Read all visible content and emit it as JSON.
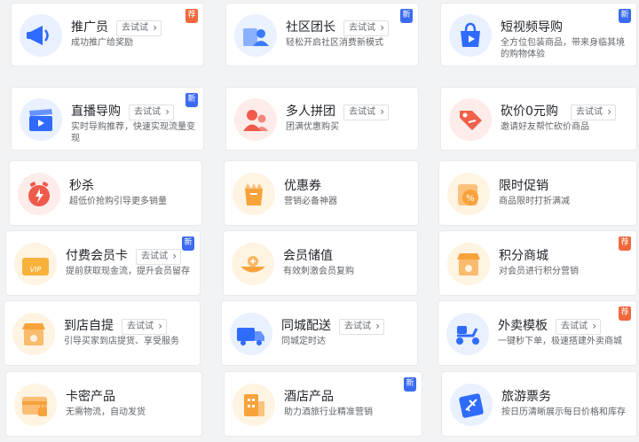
{
  "try_label": "去试试",
  "badge_colors": {
    "荐": "#f0683c",
    "新": "#3b6bf0"
  },
  "cards": [
    {
      "title": "推广员",
      "desc": "成功推广给奖励",
      "try": true,
      "badge": "荐",
      "icon": "megaphone-icon",
      "color": "#2f6bff",
      "bg": "#e9f0ff"
    },
    {
      "title": "社区团长",
      "desc": "轻松开启社区消费新模式",
      "try": true,
      "badge": "新",
      "icon": "community-leader-icon",
      "color": "#3a7bff",
      "bg": "#eaf1ff"
    },
    {
      "title": "短视频导购",
      "desc": "全方位包装商品，带来身临其境的购物体验",
      "try": false,
      "badge": "新",
      "icon": "video-shopping-bag-icon",
      "color": "#2f6bff",
      "bg": "#e9f0ff"
    },
    {
      "title": "直播导购",
      "desc": "实时导购推荐，快速实现流量变现",
      "try": true,
      "badge": "新",
      "icon": "clapperboard-icon",
      "color": "#2f6bff",
      "bg": "#e9f0ff"
    },
    {
      "title": "多人拼团",
      "desc": "团满优惠购买",
      "try": true,
      "badge": "",
      "icon": "group-buy-icon",
      "color": "#f05a4a",
      "bg": "#fdecea"
    },
    {
      "title": "砍价0元购",
      "desc": "邀请好友帮忙砍价商品",
      "try": true,
      "badge": "",
      "icon": "bargain-tag-icon",
      "color": "#f0604a",
      "bg": "#fdecea"
    },
    {
      "title": "秒杀",
      "desc": "超低价抢购引导更多销量",
      "try": false,
      "badge": "",
      "icon": "flash-sale-clock-icon",
      "color": "#f05a4a",
      "bg": "#fdecea"
    },
    {
      "title": "优惠券",
      "desc": "营销必备神器",
      "try": false,
      "badge": "",
      "icon": "coupon-icon",
      "color": "#f7a23b",
      "bg": "#fff3e2"
    },
    {
      "title": "限时促销",
      "desc": "商品限时打折满减",
      "try": false,
      "badge": "",
      "icon": "timed-discount-icon",
      "color": "#f7a23b",
      "bg": "#fff3e2"
    },
    {
      "title": "付费会员卡",
      "desc": "提前获取现金流，提升会员留存",
      "try": true,
      "badge": "新",
      "icon": "vip-card-icon",
      "color": "#f7b23b",
      "bg": "#fff3e2"
    },
    {
      "title": "会员储值",
      "desc": "有效刺激会员复购",
      "try": false,
      "badge": "",
      "icon": "stored-value-icon",
      "color": "#f7a23b",
      "bg": "#fff3e2"
    },
    {
      "title": "积分商城",
      "desc": "对会员进行积分营销",
      "try": false,
      "badge": "荐",
      "icon": "points-mall-icon",
      "color": "#f7a23b",
      "bg": "#fff3e2"
    },
    {
      "title": "到店自提",
      "desc": "引导买家到店提货、享受服务",
      "try": true,
      "badge": "",
      "icon": "store-pickup-icon",
      "color": "#f7a23b",
      "bg": "#fff3e2"
    },
    {
      "title": "同城配送",
      "desc": "同城定时达",
      "try": true,
      "badge": "",
      "icon": "delivery-truck-icon",
      "color": "#2f6bff",
      "bg": "#e9f0ff"
    },
    {
      "title": "外卖模板",
      "desc": "一键秒下单，极速搭建外卖商城",
      "try": true,
      "badge": "荐",
      "icon": "scooter-icon",
      "color": "#2f6bff",
      "bg": "#e9f0ff"
    },
    {
      "title": "卡密产品",
      "desc": "无需物流，自动发货",
      "try": false,
      "badge": "",
      "icon": "card-key-icon",
      "color": "#f7a23b",
      "bg": "#fff3e2"
    },
    {
      "title": "酒店产品",
      "desc": "助力酒旅行业精准营销",
      "try": false,
      "badge": "新",
      "icon": "hotel-icon",
      "color": "#f7a23b",
      "bg": "#fff3e2"
    },
    {
      "title": "旅游票务",
      "desc": "按日历清晰展示每日价格和库存",
      "try": false,
      "badge": "",
      "icon": "airplane-ticket-icon",
      "color": "#2f6bff",
      "bg": "#e9f0ff"
    }
  ]
}
